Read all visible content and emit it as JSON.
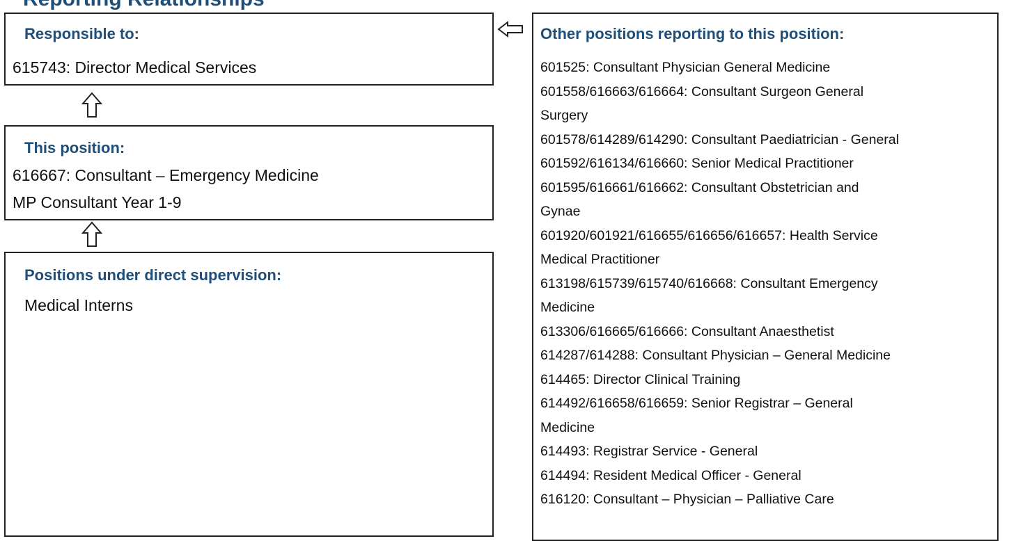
{
  "page": {
    "heading": "Reporting Relationships"
  },
  "responsible": {
    "heading": "Responsible to:",
    "position": "615743: Director Medical Services"
  },
  "this_position": {
    "heading": "This position:",
    "lines": [
      "616667: Consultant – Emergency Medicine",
      "MP Consultant Year 1-9"
    ]
  },
  "supervision": {
    "heading": "Positions under direct supervision:",
    "positions": [
      "Medical Interns"
    ]
  },
  "other_positions": {
    "heading": "Other positions reporting to this position:",
    "lines": [
      "601525: Consultant Physician General Medicine",
      "601558/616663/616664: Consultant Surgeon General",
      "Surgery",
      "601578/614289/614290: Consultant Paediatrician - General",
      "601592/616134/616660: Senior Medical Practitioner",
      "601595/616661/616662: Consultant Obstetrician and",
      "Gynae",
      "601920/601921/616655/616656/616657: Health Service",
      "Medical Practitioner",
      "613198/615739/615740/616668: Consultant Emergency",
      "Medicine",
      "613306/616665/616666: Consultant Anaesthetist",
      "614287/614288: Consultant Physician – General Medicine",
      "614465: Director Clinical Training",
      "614492/616658/616659: Senior Registrar – General",
      "Medicine",
      "614493: Registrar Service - General",
      "614494: Resident Medical Officer - General",
      "616120: Consultant – Physician – Palliative Care"
    ]
  },
  "icons": {
    "arrow_up": "arrow-up-icon",
    "arrow_left": "arrow-left-icon"
  },
  "colors": {
    "heading": "#1f4e79",
    "border": "#222222",
    "text": "#111111"
  }
}
